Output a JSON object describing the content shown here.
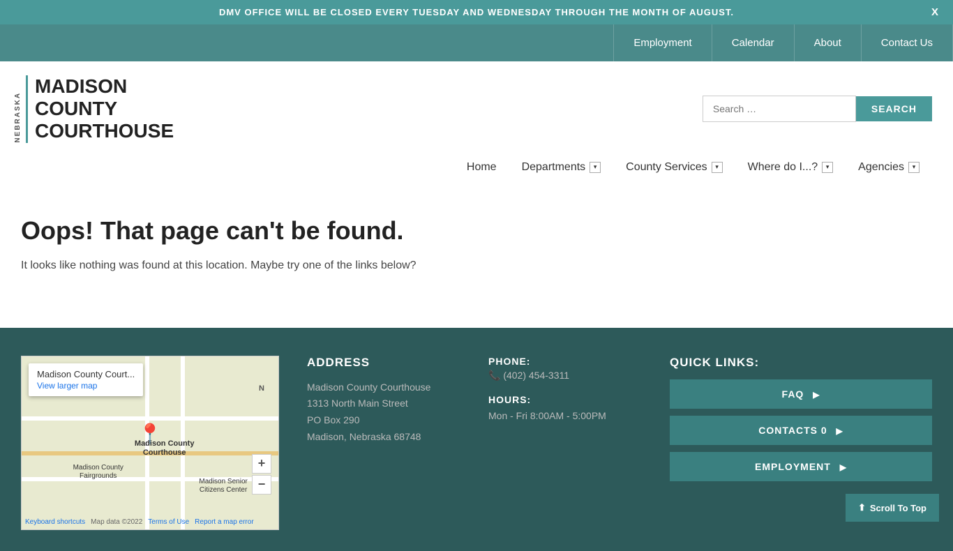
{
  "alert": {
    "text": "DMV OFFICE WILL BE CLOSED EVERY TUESDAY AND WEDNESDAY THROUGH THE MONTH OF AUGUST.",
    "close_label": "X"
  },
  "top_nav": {
    "items": [
      {
        "label": "Employment",
        "id": "employment"
      },
      {
        "label": "Calendar",
        "id": "calendar"
      },
      {
        "label": "About",
        "id": "about"
      },
      {
        "label": "Contact Us",
        "id": "contact-us"
      }
    ]
  },
  "header": {
    "logo_sidebar": "NEBRASKA",
    "logo_line1": "MADISON",
    "logo_line2": "COUNTY",
    "logo_line3": "COURTHOUSE",
    "search_placeholder": "Search …",
    "search_button": "SEARCH"
  },
  "main_nav": {
    "items": [
      {
        "label": "Home",
        "has_dropdown": false
      },
      {
        "label": "Departments",
        "has_dropdown": true
      },
      {
        "label": "County Services",
        "has_dropdown": true
      },
      {
        "label": "Where do I...?",
        "has_dropdown": true
      },
      {
        "label": "Agencies",
        "has_dropdown": true
      }
    ]
  },
  "error_page": {
    "heading": "Oops! That page can't be found.",
    "subtext": "It looks like nothing was found at this location. Maybe try one of the links below?"
  },
  "footer": {
    "address_title": "ADDRESS",
    "address_lines": [
      "Madison County Courthouse",
      "1313 North Main Street",
      "PO Box 290",
      "Madison, Nebraska 68748"
    ],
    "phone_label": "PHONE:",
    "phone_icon": "📞",
    "phone_number": "(402) 454-3311",
    "hours_label": "HOURS:",
    "hours_text": "Mon - Fri 8:00AM - 5:00PM",
    "quick_links_title": "QUICK LINKS:",
    "quick_links": [
      {
        "label": "FAQ",
        "arrow": "▶"
      },
      {
        "label": "CONTACTS  0",
        "arrow": "▶"
      },
      {
        "label": "EMPLOYMENT",
        "arrow": "▶"
      }
    ],
    "map": {
      "tooltip_name": "Madison County Court...",
      "tooltip_link": "View larger map",
      "pin_label1": "Madison County",
      "pin_label2": "Courthouse",
      "landmark1": "Madison County",
      "landmark1b": "Fairgrounds",
      "landmark2": "Madison Senior",
      "landmark2b": "Citizens Center",
      "keyboard_shortcuts": "Keyboard shortcuts",
      "map_data": "Map data ©2022",
      "terms": "Terms of Use",
      "report": "Report a map error",
      "compass": "N"
    }
  },
  "scroll_top": {
    "icon": "⬆",
    "label": "Scroll To Top"
  }
}
